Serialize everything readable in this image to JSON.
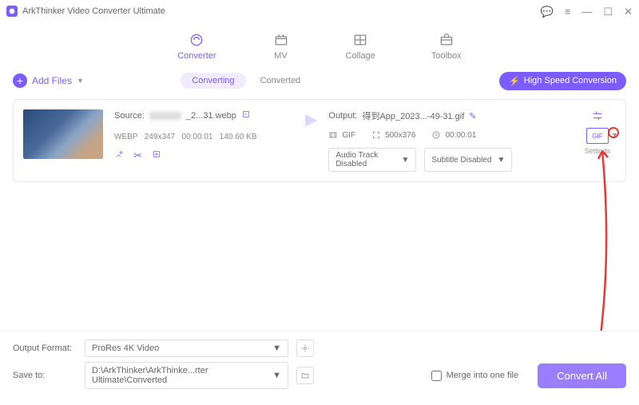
{
  "app": {
    "title": "ArkThinker Video Converter Ultimate"
  },
  "tabs": {
    "converter": "Converter",
    "mv": "MV",
    "collage": "Collage",
    "toolbox": "Toolbox"
  },
  "toolbar": {
    "add_files": "Add Files",
    "converting": "Converting",
    "converted": "Converted",
    "high_speed": "High Speed Conversion"
  },
  "item": {
    "source_label": "Source:",
    "source_suffix": "_2...31.webp",
    "format": "WEBP",
    "resolution": "249x347",
    "duration": "00:00:01",
    "size": "140.60 KB",
    "output_label": "Output:",
    "output_name": "得到App_2023...-49-31.gif",
    "out_format": "GIF",
    "out_res": "500x376",
    "out_dur": "00:00:01",
    "audio_dd": "Audio Track Disabled",
    "subtitle_dd": "Subtitle Disabled",
    "format_badge": "GIF",
    "settings": "Settings"
  },
  "footer": {
    "output_format_label": "Output Format:",
    "output_format_value": "ProRes 4K Video",
    "save_to_label": "Save to:",
    "save_to_value": "D:\\ArkThinker\\ArkThinke...rter Ultimate\\Converted",
    "merge": "Merge into one file",
    "convert": "Convert All"
  }
}
